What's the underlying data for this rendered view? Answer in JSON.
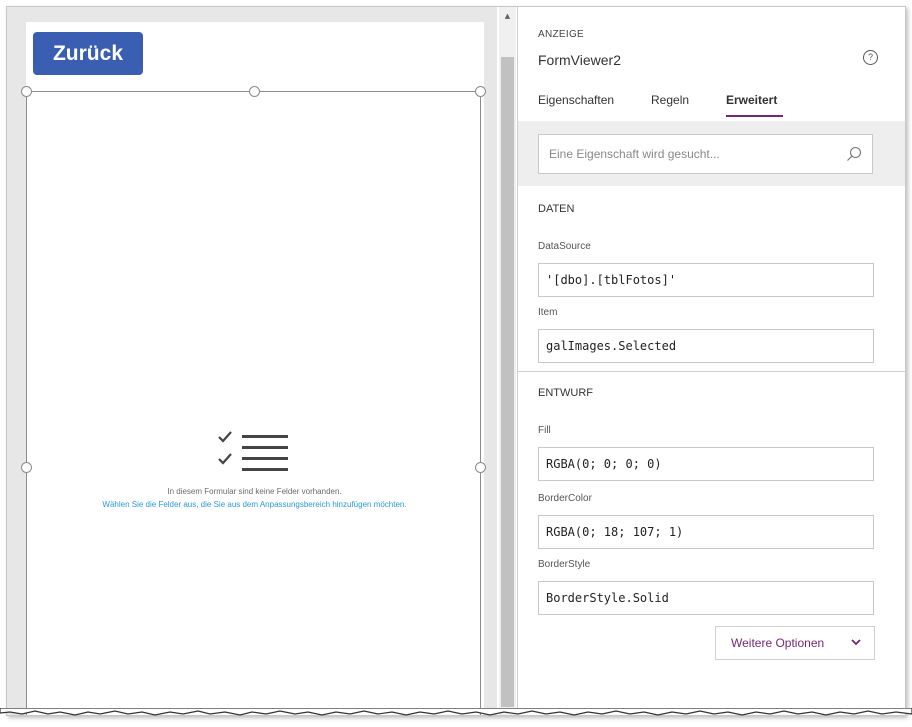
{
  "colors": {
    "accent": "#742774",
    "back_button_bg": "#3a5fb2",
    "link_blue": "#2b9ad8",
    "muted_text": "#6b6b6b"
  },
  "canvas": {
    "back_button_label": "Zurück",
    "empty_message": "In diesem Formular sind keine Felder vorhanden.",
    "empty_link": "Wählen Sie die Felder aus, die Sie aus dem Anpassungsbereich hinzufügen möchten."
  },
  "panel": {
    "kicker": "ANZEIGE",
    "title": "FormViewer2",
    "help_icon": "question-icon",
    "tabs": [
      {
        "label": "Eigenschaften",
        "active": false
      },
      {
        "label": "Regeln",
        "active": false
      },
      {
        "label": "Erweitert",
        "active": true
      }
    ],
    "search": {
      "placeholder": "Eine Eigenschaft wird gesucht...",
      "value": "",
      "icon": "search-icon"
    },
    "sections": [
      {
        "heading": "DATEN",
        "properties": [
          {
            "label": "DataSource",
            "value": "'[dbo].[tblFotos]'"
          },
          {
            "label": "Item",
            "value": "galImages.Selected"
          }
        ]
      },
      {
        "heading": "ENTWURF",
        "properties": [
          {
            "label": "Fill",
            "value": "RGBA(0; 0; 0; 0)"
          },
          {
            "label": "BorderColor",
            "value": "RGBA(0; 18; 107; 1)"
          },
          {
            "label": "BorderStyle",
            "value": "BorderStyle.Solid"
          }
        ]
      }
    ],
    "more_options_label": "Weitere Optionen",
    "more_options_icon": "chevron-down-icon"
  }
}
